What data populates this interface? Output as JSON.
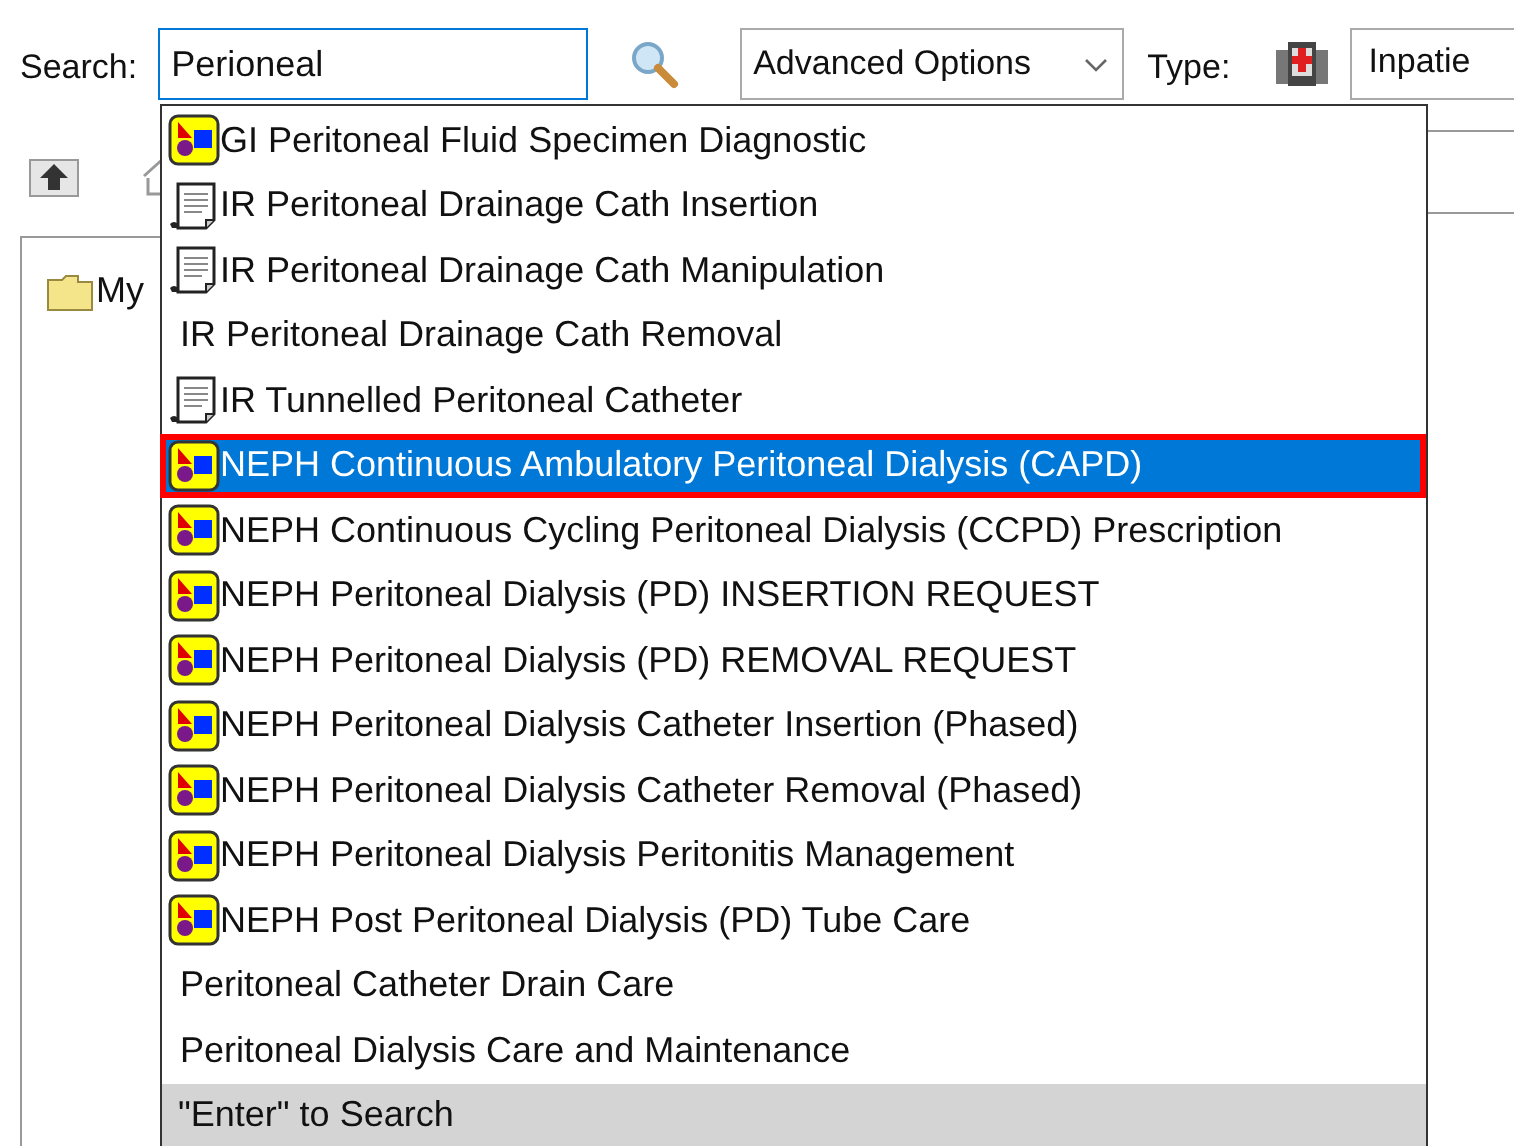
{
  "search": {
    "label": "Search:",
    "value": "Perioneal"
  },
  "advanced": {
    "label": "Advanced Options"
  },
  "type": {
    "label": "Type:",
    "value": "Inpatie"
  },
  "tree": {
    "items": [
      {
        "label": "My"
      }
    ]
  },
  "dropdown": {
    "items": [
      {
        "kind": "order",
        "label": "GI Peritoneal Fluid Specimen Diagnostic",
        "selected": false
      },
      {
        "kind": "document",
        "label": "IR Peritoneal Drainage Cath Insertion",
        "selected": false
      },
      {
        "kind": "document",
        "label": "IR Peritoneal Drainage Cath Manipulation",
        "selected": false
      },
      {
        "kind": "plain",
        "label": "IR Peritoneal Drainage Cath Removal",
        "selected": false
      },
      {
        "kind": "document",
        "label": "IR Tunnelled Peritoneal Catheter",
        "selected": false
      },
      {
        "kind": "order",
        "label": "NEPH Continuous Ambulatory Peritoneal Dialysis (CAPD)",
        "selected": true
      },
      {
        "kind": "order",
        "label": "NEPH Continuous Cycling Peritoneal Dialysis (CCPD) Prescription",
        "selected": false
      },
      {
        "kind": "order",
        "label": "NEPH Peritoneal Dialysis (PD) INSERTION REQUEST",
        "selected": false
      },
      {
        "kind": "order",
        "label": "NEPH Peritoneal Dialysis (PD) REMOVAL REQUEST",
        "selected": false
      },
      {
        "kind": "order",
        "label": "NEPH Peritoneal Dialysis Catheter Insertion (Phased)",
        "selected": false
      },
      {
        "kind": "order",
        "label": "NEPH Peritoneal Dialysis Catheter Removal (Phased)",
        "selected": false
      },
      {
        "kind": "order",
        "label": "NEPH Peritoneal Dialysis Peritonitis Management",
        "selected": false
      },
      {
        "kind": "order",
        "label": "NEPH Post Peritoneal Dialysis (PD) Tube Care",
        "selected": false
      },
      {
        "kind": "plain",
        "label": "Peritoneal Catheter Drain Care",
        "selected": false
      },
      {
        "kind": "plain",
        "label": "Peritoneal Dialysis Care and Maintenance",
        "selected": false
      }
    ],
    "footer": "\"Enter\" to Search"
  }
}
